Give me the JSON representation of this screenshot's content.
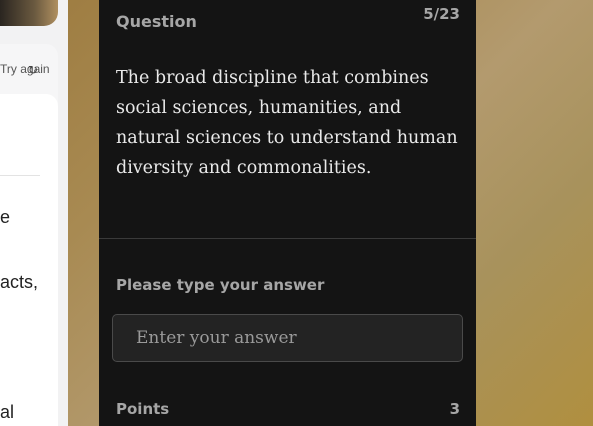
{
  "left_panel": {
    "again_text": "Try again",
    "refresh_glyph": "↻",
    "fragments": [
      "e",
      "acts,",
      "al"
    ]
  },
  "question": {
    "label": "Question",
    "counter": "5/23",
    "text": "The broad discipline that combines social sciences, humanities, and natural sciences to understand human diversity and commonalities."
  },
  "answer": {
    "label": "Please type your answer",
    "placeholder": "Enter your answer",
    "value": ""
  },
  "points": {
    "label": "Points",
    "value": "3"
  }
}
